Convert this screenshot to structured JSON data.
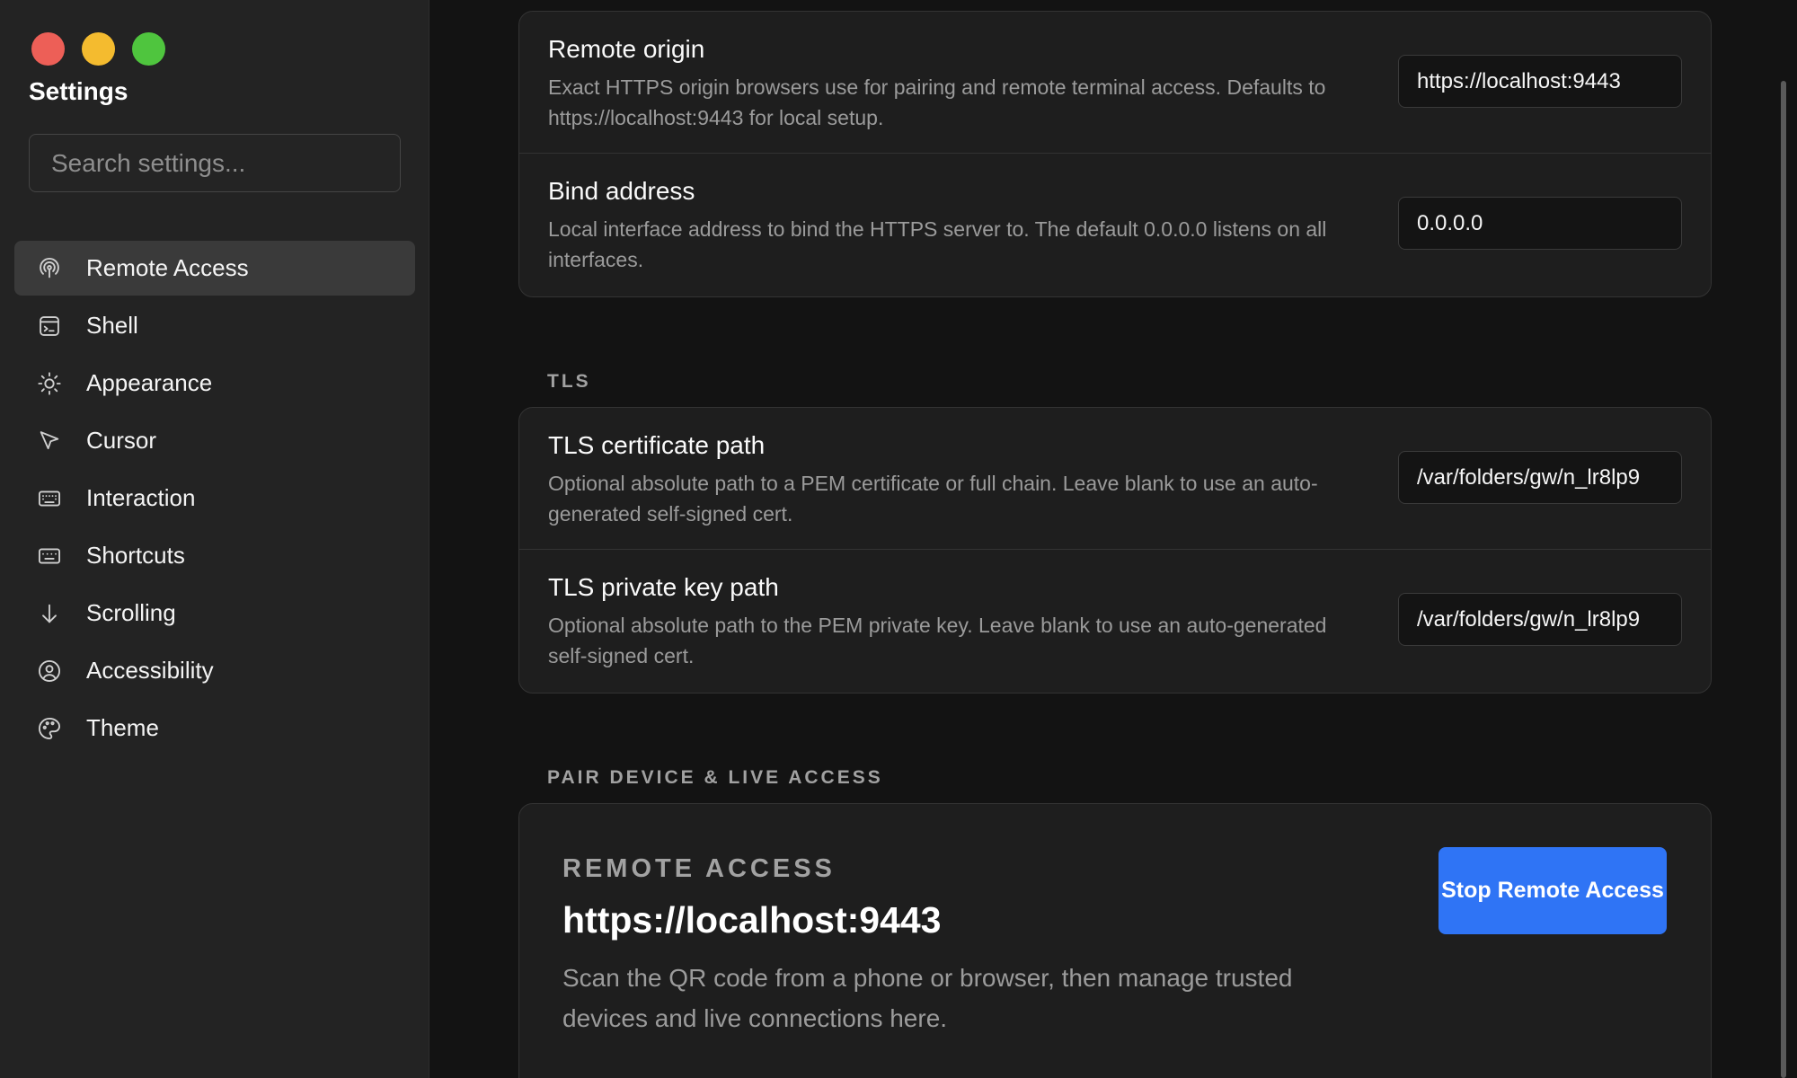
{
  "window": {
    "controls": [
      "close",
      "minimize",
      "maximize"
    ]
  },
  "sidebar": {
    "title": "Settings",
    "search": {
      "placeholder": "Search settings...",
      "value": ""
    },
    "items": [
      {
        "label": "Remote Access",
        "icon": "remote-access-icon",
        "active": true
      },
      {
        "label": "Shell",
        "icon": "terminal-icon",
        "active": false
      },
      {
        "label": "Appearance",
        "icon": "sun-icon",
        "active": false
      },
      {
        "label": "Cursor",
        "icon": "pointer-icon",
        "active": false
      },
      {
        "label": "Interaction",
        "icon": "keyboard-icon",
        "active": false
      },
      {
        "label": "Shortcuts",
        "icon": "keyboard-shortcuts-icon",
        "active": false
      },
      {
        "label": "Scrolling",
        "icon": "arrow-down-icon",
        "active": false
      },
      {
        "label": "Accessibility",
        "icon": "person-circle-icon",
        "active": false
      },
      {
        "label": "Theme",
        "icon": "palette-icon",
        "active": false
      }
    ]
  },
  "server": {
    "rows": [
      {
        "title": "Remote origin",
        "description": "Exact HTTPS origin browsers use for pairing and remote terminal access. Defaults to https://localhost:9443 for local setup.",
        "value": "https://localhost:9443"
      },
      {
        "title": "Bind address",
        "description": "Local interface address to bind the HTTPS server to. The default 0.0.0.0 listens on all interfaces.",
        "value": "0.0.0.0"
      }
    ]
  },
  "tls": {
    "section_label": "TLS",
    "rows": [
      {
        "title": "TLS certificate path",
        "description": "Optional absolute path to a PEM certificate or full chain. Leave blank to use an auto-generated self-signed cert.",
        "value": "/var/folders/gw/n_lr8lp9"
      },
      {
        "title": "TLS private key path",
        "description": "Optional absolute path to the PEM private key. Leave blank to use an auto-generated self-signed cert.",
        "value": "/var/folders/gw/n_lr8lp9"
      }
    ]
  },
  "pair": {
    "section_label": "PAIR DEVICE & LIVE ACCESS",
    "kicker": "REMOTE ACCESS",
    "url": "https://localhost:9443",
    "description": "Scan the QR code from a phone or browser, then manage trusted devices and live connections here.",
    "button_label": "Stop Remote Access",
    "button_color": "#2f74f5"
  }
}
